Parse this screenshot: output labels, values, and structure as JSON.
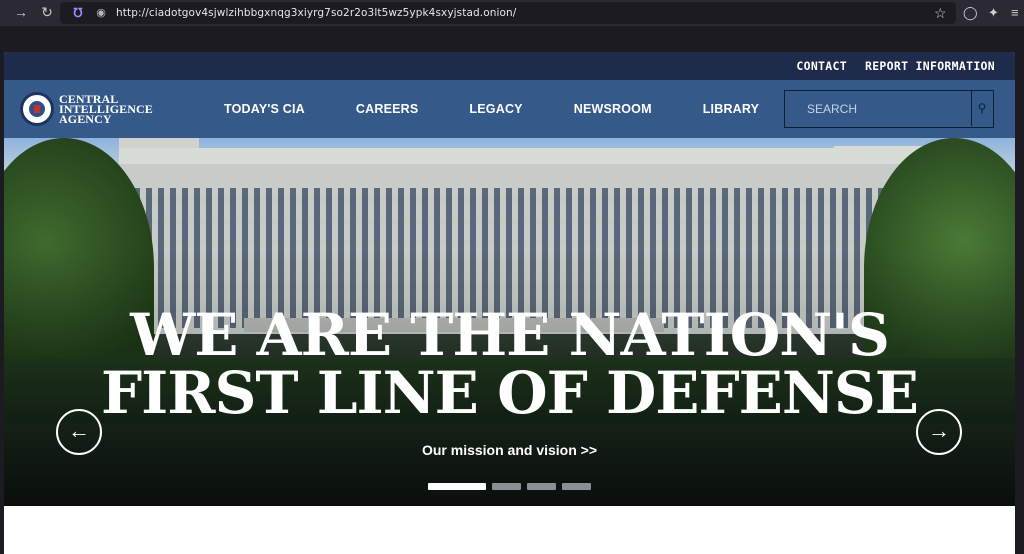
{
  "browser": {
    "url": "http://ciadotgov4sjwlzihbbgxnqg3xiyrg7so2r2o3lt5wz5ypk4sxyjstad.onion/"
  },
  "utility_nav": {
    "contact": "CONTACT",
    "report": "REPORT INFORMATION"
  },
  "logo": {
    "line1": "CENTRAL",
    "line2": "INTELLIGENCE",
    "line3": "AGENCY"
  },
  "nav": {
    "items": [
      {
        "label": "TODAY'S CIA"
      },
      {
        "label": "CAREERS"
      },
      {
        "label": "LEGACY"
      },
      {
        "label": "NEWSROOM"
      },
      {
        "label": "LIBRARY"
      }
    ]
  },
  "search": {
    "placeholder": "SEARCH"
  },
  "hero": {
    "headline_line1": "WE ARE THE NATION'S",
    "headline_line2": "FIRST LINE OF DEFENSE",
    "link_text": "Our mission and vision >>",
    "slides_total": 4,
    "active_slide": 1
  },
  "colors": {
    "utility_bar": "#1e2b4a",
    "main_nav": "#355a8a"
  }
}
